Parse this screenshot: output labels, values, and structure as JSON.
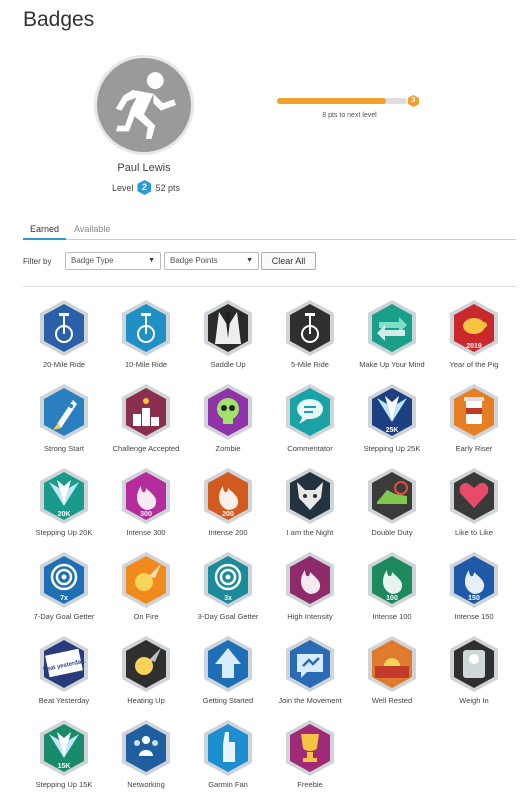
{
  "page": {
    "title": "Badges"
  },
  "profile": {
    "name": "Paul Lewis",
    "level_label": "Level",
    "level": "2",
    "points": "52 pts",
    "avatar_icon": "runner-icon"
  },
  "progress": {
    "to_next": "8 pts to next level",
    "fraction": 0.84,
    "next_level_mark": "3"
  },
  "tabs": [
    {
      "label": "Earned",
      "active": true
    },
    {
      "label": "Available",
      "active": false
    }
  ],
  "filter": {
    "label": "Filter by",
    "badge_type": "Badge Type",
    "badge_points": "Badge Points",
    "clear_label": "Clear All"
  },
  "colors": {
    "accent": "#2e9bd6",
    "progress": "#f0a02b"
  },
  "badges": [
    {
      "label": "20-Mile Ride",
      "bg": "#2b5fa8",
      "icon": "unicycle-icon",
      "text": ""
    },
    {
      "label": "10-Mile Ride",
      "bg": "#1f8fc6",
      "icon": "unicycle-icon",
      "text": ""
    },
    {
      "label": "Saddle Up",
      "bg": "#2b2b2b",
      "icon": "tuxedo-icon",
      "text": ""
    },
    {
      "label": "5-Mile Ride",
      "bg": "#2f2f2f",
      "icon": "unicycle-icon",
      "text": ""
    },
    {
      "label": "Make Up Your Mind",
      "bg": "#1aa088",
      "icon": "arrows-icon",
      "text": ""
    },
    {
      "label": "Year of the Pig",
      "bg": "#c9282d",
      "icon": "pig-icon",
      "text": "2019"
    },
    {
      "label": "Strong Start",
      "bg": "#2a7fc1",
      "icon": "rocket-icon",
      "text": ""
    },
    {
      "label": "Challenge Accepted",
      "bg": "#8a2f4e",
      "icon": "podium-icon",
      "text": ""
    },
    {
      "label": "Zombie",
      "bg": "#8e33a8",
      "icon": "skull-icon",
      "text": ""
    },
    {
      "label": "Commentator",
      "bg": "#1aa3a6",
      "icon": "speech-bubble-icon",
      "text": ""
    },
    {
      "label": "Stepping Up 25K",
      "bg": "#1e3f82",
      "icon": "wings-icon",
      "text": "25K"
    },
    {
      "label": "Early Riser",
      "bg": "#e67e22",
      "icon": "coffee-icon",
      "text": ""
    },
    {
      "label": "Stepping Up 20K",
      "bg": "#1a9b8a",
      "icon": "wings-icon",
      "text": "20K"
    },
    {
      "label": "Intense 300",
      "bg": "#b52c9c",
      "icon": "flame-icon",
      "text": "300"
    },
    {
      "label": "Intense 200",
      "bg": "#d35a1e",
      "icon": "flame-icon",
      "text": "200"
    },
    {
      "label": "I am the Night",
      "bg": "#23323f",
      "icon": "wolf-icon",
      "text": ""
    },
    {
      "label": "Double Duty",
      "bg": "#3b3b3b",
      "icon": "shoe-icon",
      "text": ""
    },
    {
      "label": "Like to Like",
      "bg": "#3a3a3a",
      "icon": "heart-icon",
      "text": ""
    },
    {
      "label": "7-Day Goal Getter",
      "bg": "#1f6fb5",
      "icon": "target-icon",
      "text": "7x"
    },
    {
      "label": "On Fire",
      "bg": "#f08a1c",
      "icon": "fireball-icon",
      "text": ""
    },
    {
      "label": "3-Day Goal Getter",
      "bg": "#1a8b9a",
      "icon": "target-icon",
      "text": "3x"
    },
    {
      "label": "High Intensity",
      "bg": "#8e2b6a",
      "icon": "flame-icon",
      "text": ""
    },
    {
      "label": "Intense 100",
      "bg": "#1c8a5a",
      "icon": "flame-icon",
      "text": "100"
    },
    {
      "label": "Intense 150",
      "bg": "#1f5aa8",
      "icon": "flame-icon",
      "text": "150"
    },
    {
      "label": "Beat Yesterday",
      "bg": "#2a3b7c",
      "icon": "beat-yesterday-icon",
      "text": "beat yesterday."
    },
    {
      "label": "Heating Up",
      "bg": "#2f2f2f",
      "icon": "fireball-icon",
      "text": ""
    },
    {
      "label": "Getting Started",
      "bg": "#1e6fb8",
      "icon": "arrow-up-icon",
      "text": ""
    },
    {
      "label": "Join the Movement",
      "bg": "#2a6bb5",
      "icon": "bolt-bubble-icon",
      "text": ""
    },
    {
      "label": "Well Rested",
      "bg": "#e07a2c",
      "icon": "sunset-icon",
      "text": ""
    },
    {
      "label": "Weigh In",
      "bg": "#2f2f2f",
      "icon": "scale-icon",
      "text": ""
    },
    {
      "label": "Stepping Up 15K",
      "bg": "#1a8b6a",
      "icon": "wings-icon",
      "text": "15K"
    },
    {
      "label": "Networking",
      "bg": "#1f5fa0",
      "icon": "people-icon",
      "text": ""
    },
    {
      "label": "Garmin Fan",
      "bg": "#1d8ed0",
      "icon": "foam-finger-icon",
      "text": ""
    },
    {
      "label": "Freebie",
      "bg": "#a02a78",
      "icon": "trophy-icon",
      "text": ""
    }
  ]
}
